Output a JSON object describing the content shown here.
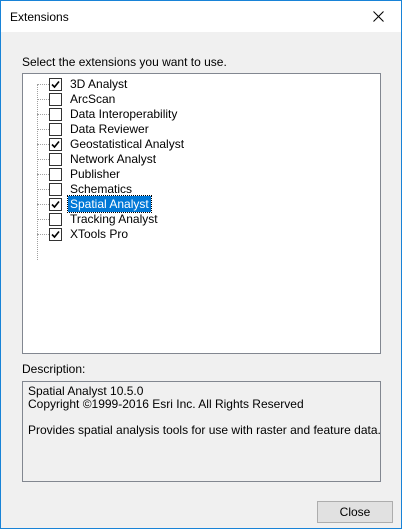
{
  "window": {
    "title": "Extensions",
    "close_icon": "close-x-icon",
    "accent_color": "#1883d7"
  },
  "instructions": "Select the extensions you want to use.",
  "extensions": [
    {
      "label": "3D Analyst",
      "checked": true,
      "selected": false
    },
    {
      "label": "ArcScan",
      "checked": false,
      "selected": false
    },
    {
      "label": "Data Interoperability",
      "checked": false,
      "selected": false
    },
    {
      "label": "Data Reviewer",
      "checked": false,
      "selected": false
    },
    {
      "label": "Geostatistical Analyst",
      "checked": true,
      "selected": false
    },
    {
      "label": "Network Analyst",
      "checked": false,
      "selected": false
    },
    {
      "label": "Publisher",
      "checked": false,
      "selected": false
    },
    {
      "label": "Schematics",
      "checked": false,
      "selected": false
    },
    {
      "label": "Spatial Analyst",
      "checked": true,
      "selected": true
    },
    {
      "label": "Tracking Analyst",
      "checked": false,
      "selected": false
    },
    {
      "label": "XTools Pro",
      "checked": true,
      "selected": false
    }
  ],
  "description": {
    "label": "Description:",
    "line1": "Spatial Analyst 10.5.0",
    "line2": "Copyright ©1999-2016 Esri Inc. All Rights Reserved",
    "line3": "Provides spatial analysis tools for use with raster and feature data."
  },
  "buttons": {
    "close_label": "Close"
  }
}
